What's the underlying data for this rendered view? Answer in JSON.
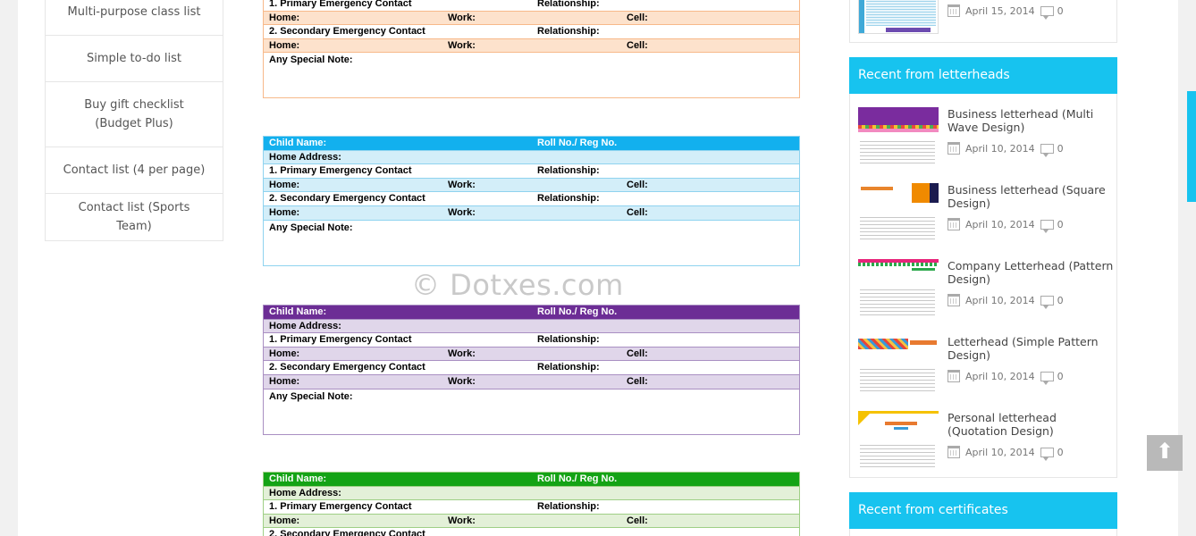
{
  "left_nav": {
    "items": [
      {
        "label": "Multi-purpose class list"
      },
      {
        "label": "Simple to-do list"
      },
      {
        "label": "Buy gift checklist (Budget Plus)"
      },
      {
        "label": "Contact list (4 per page)"
      },
      {
        "label": "Contact list (Sports Team)"
      }
    ]
  },
  "form_labels": {
    "child_name": "Child Name:",
    "roll_no": "Roll No./ Reg No.",
    "home_address": "Home Address:",
    "primary": "1. Primary Emergency Contact",
    "secondary": "2. Secondary Emergency Contact",
    "relationship": "Relationship:",
    "home": "Home:",
    "work": "Work:",
    "cell": "Cell:",
    "note": "Any Special Note:"
  },
  "form_colors": {
    "orange": {
      "border": "#f7b98a",
      "band": "#fde2cc"
    },
    "blue": {
      "head": "#12b0ee",
      "border": "#8fd3ef",
      "band": "#d3eef9"
    },
    "purple": {
      "head": "#6c2d95",
      "border": "#a98fc2",
      "band": "#e0d6ea"
    },
    "green": {
      "head": "#14a315",
      "border": "#9fcf86",
      "band": "#e3f0d8"
    }
  },
  "watermark": "© Dotxes.com",
  "right_sidebar": {
    "top_post": {
      "date": "April 15, 2014",
      "comments": "0"
    },
    "letterheads_heading": "Recent from letterheads",
    "posts": [
      {
        "title": "Business letterhead (Multi Wave Design)",
        "date": "April 10, 2014",
        "comments": "0"
      },
      {
        "title": "Business letterhead (Square Design)",
        "date": "April 10, 2014",
        "comments": "0"
      },
      {
        "title": "Company Letterhead (Pattern Design)",
        "date": "April 10, 2014",
        "comments": "0"
      },
      {
        "title": "Letterhead (Simple Pattern Design)",
        "date": "April 10, 2014",
        "comments": "0"
      },
      {
        "title": "Personal letterhead (Quotation Design)",
        "date": "April 10, 2014",
        "comments": "0"
      }
    ],
    "certificates_heading": "Recent from certificates"
  },
  "accent_color": "#17c3ef",
  "icons": [
    "calendar-icon",
    "comment-icon",
    "arrow-up-icon"
  ]
}
